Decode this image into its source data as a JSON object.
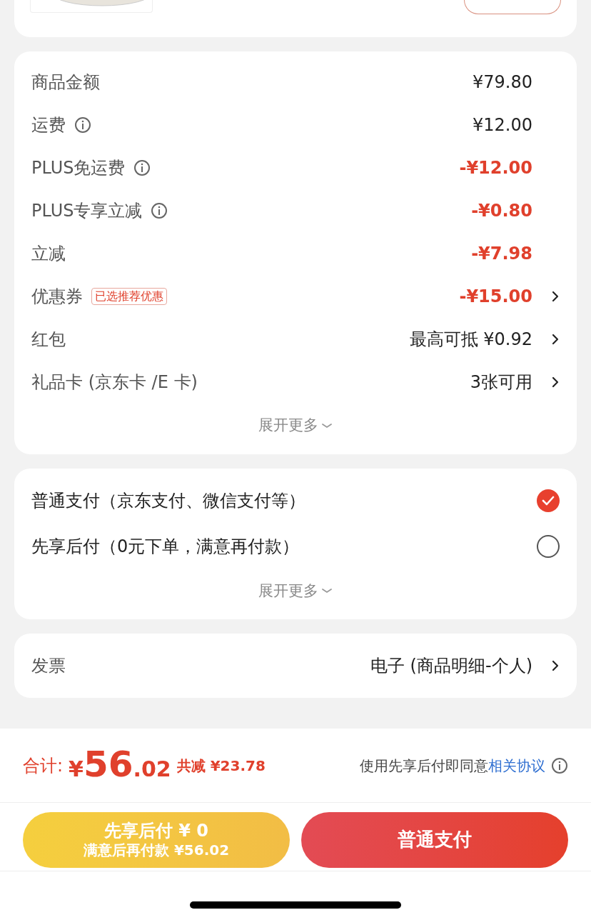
{
  "summary": {
    "rows": [
      {
        "kind": "plain",
        "label": "商品金额",
        "value": "¥79.80",
        "info": false,
        "red": false,
        "arrow": false
      },
      {
        "kind": "plain",
        "label": "运费",
        "value": "¥12.00",
        "info": true,
        "red": false,
        "arrow": false
      },
      {
        "kind": "plain",
        "label": "PLUS免运费",
        "value": "-¥12.00",
        "info": true,
        "red": true,
        "arrow": false
      },
      {
        "kind": "plain",
        "label": "PLUS专享立减",
        "value": "-¥0.80",
        "info": true,
        "red": true,
        "arrow": false
      },
      {
        "kind": "plain",
        "label": "立减",
        "value": "-¥7.98",
        "info": false,
        "red": true,
        "arrow": false
      },
      {
        "kind": "tagged",
        "label": "优惠券",
        "tag": "已选推荐优惠",
        "value": "-¥15.00",
        "info": false,
        "red": true,
        "arrow": true
      },
      {
        "kind": "plain",
        "label": "红包",
        "value": "最高可抵 ¥0.92",
        "info": false,
        "red": false,
        "arrow": true
      },
      {
        "kind": "plain",
        "label": "礼品卡 (京东卡 /E 卡)",
        "value": "3张可用",
        "info": false,
        "red": false,
        "arrow": true
      }
    ],
    "more": "展开更多"
  },
  "payment": {
    "options": [
      {
        "label": "普通支付（京东支付、微信支付等）",
        "selected": true
      },
      {
        "label": "先享后付（0元下单，满意再付款）",
        "selected": false
      }
    ],
    "more": "展开更多"
  },
  "invoice": {
    "label": "发票",
    "value": "电子 (商品明细-个人)"
  },
  "footer": {
    "total_label": "合计:",
    "currency": "¥",
    "total_int": "56",
    "total_dec": ".02",
    "saved": "共减 ¥23.78",
    "agree_text": "使用先享后付即同意",
    "agree_link": "相关协议",
    "later_button": {
      "title": "先享后付 ¥ 0",
      "subtitle": "满意后再付款 ¥56.02"
    },
    "pay_button": "普通支付"
  }
}
